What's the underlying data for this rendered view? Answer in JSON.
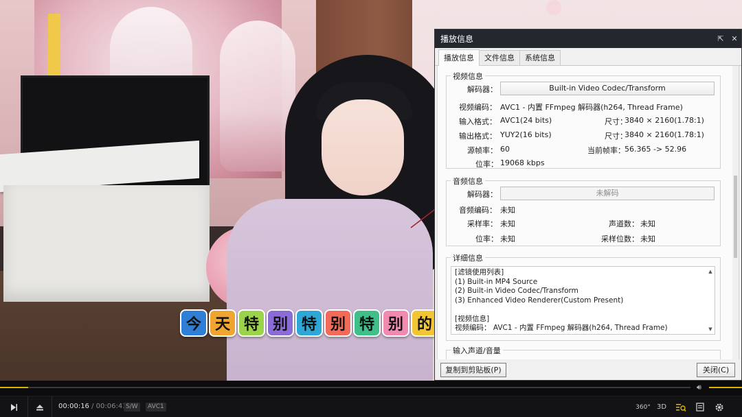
{
  "panel": {
    "title": "播放信息",
    "pin_icon": "pin-icon",
    "close_icon": "close-icon",
    "tabs": [
      {
        "label": "播放信息",
        "active": true
      },
      {
        "label": "文件信息",
        "active": false
      },
      {
        "label": "系统信息",
        "active": false
      }
    ],
    "video": {
      "title": "视频信息",
      "decoder_label": "解码器：",
      "decoder_value": "Built-in Video Codec/Transform",
      "codec_label": "视频编码：",
      "codec_value": "AVC1 - 内置 FFmpeg 解码器(h264, Thread Frame)",
      "input_format_label": "输入格式：",
      "input_format_value": "AVC1(24 bits)",
      "input_size_label": "尺寸：",
      "input_size_value": "3840 × 2160(1.78:1)",
      "output_format_label": "输出格式：",
      "output_format_value": "YUY2(16 bits)",
      "output_size_label": "尺寸：",
      "output_size_value": "3840 × 2160(1.78:1)",
      "src_fps_label": "源帧率：",
      "src_fps_value": "60",
      "cur_fps_label": "当前帧率：",
      "cur_fps_value": "56.365 -> 52.96",
      "bitrate_label": "位率：",
      "bitrate_value": "19068 kbps"
    },
    "audio": {
      "title": "音频信息",
      "decoder_label": "解码器：",
      "decoder_value": "未解码",
      "codec_label": "音频编码：",
      "codec_value": "未知",
      "samplerate_label": "采样率：",
      "samplerate_value": "未知",
      "channels_label": "声道数：",
      "channels_value": "未知",
      "bitrate_label": "位率：",
      "bitrate_value": "未知",
      "bitdepth_label": "采样位数：",
      "bitdepth_value": "未知"
    },
    "detail": {
      "title": "详细信息",
      "lines": [
        "[滤镜使用列表]",
        "  (1) Built-in MP4 Source",
        "  (2) Built-in Video Codec/Transform",
        "  (3) Enhanced Video Renderer(Custom Present)",
        "",
        "[视频信息]",
        "  视频编码： AVC1 - 内置 FFmpeg 解码器(h264, Thread Frame)"
      ]
    },
    "input_channel_title": "输入声道/音量",
    "copy_button": "复制到剪贴板(P)",
    "close_button": "关闭(C)"
  },
  "subtitle": {
    "chars": [
      "今",
      "天",
      "特",
      "别",
      "特",
      "别",
      "特",
      "别",
      "的"
    ],
    "colors": [
      "#2f7fd6",
      "#f1a531",
      "#9bd34a",
      "#8b6bd6",
      "#2fa7d6",
      "#f26a5a",
      "#3fbf8a",
      "#f08ab0",
      "#f2c535"
    ]
  },
  "player": {
    "progress": 0.041,
    "current_time": "00:00:16",
    "separator": "/",
    "total_time": "00:06:43",
    "tag_sw": "S/W",
    "tag_codec": "AVC1",
    "btn_360": "360°",
    "btn_3d": "3D"
  }
}
